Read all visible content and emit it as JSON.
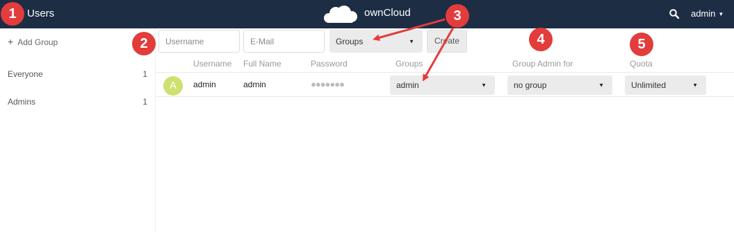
{
  "header": {
    "title": "Users",
    "brand": "ownCloud",
    "user_menu": "admin",
    "icons": {
      "search": "search-icon",
      "logo": "owncloud-logo",
      "caret": "caret-down-icon"
    }
  },
  "sidebar": {
    "add_group": "Add Group",
    "groups": [
      {
        "name": "Everyone",
        "count": "1"
      },
      {
        "name": "Admins",
        "count": "1"
      }
    ]
  },
  "new_user_form": {
    "username_placeholder": "Username",
    "email_placeholder": "E-Mail",
    "groups_select": "Groups",
    "create_button": "Create"
  },
  "table": {
    "columns": [
      "Username",
      "Full Name",
      "Password",
      "Groups",
      "Group Admin for",
      "Quota"
    ],
    "rows": [
      {
        "avatar_letter": "A",
        "username": "admin",
        "full_name": "admin",
        "password": "●●●●●●●",
        "groups": "admin",
        "group_admin_for": "no group",
        "quota": "Unlimited"
      }
    ]
  },
  "annotations": [
    "1",
    "2",
    "3",
    "4",
    "5"
  ],
  "colors": {
    "header_bg": "#1d2d44",
    "annotation_red": "#e23c3c",
    "avatar_bg": "#cfe06f",
    "select_bg": "#ebebeb"
  }
}
